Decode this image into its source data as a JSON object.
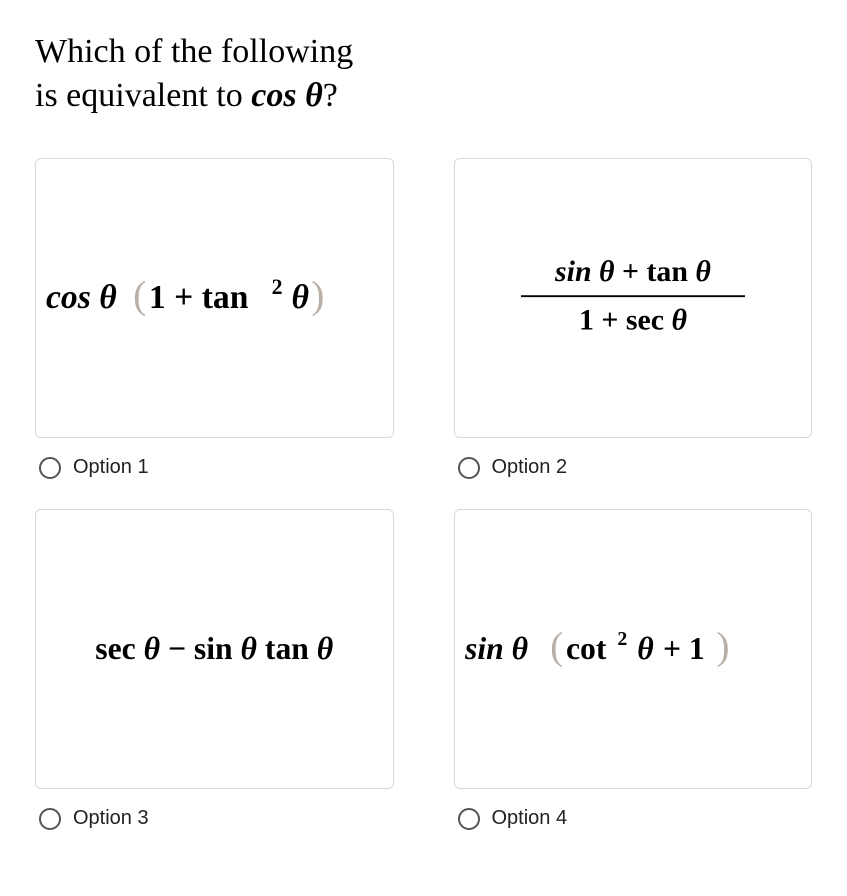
{
  "question": {
    "line1": "Which of the following",
    "line2_a": "is equivalent to ",
    "line2_math": "cos θ",
    "line2_b": "?"
  },
  "options": [
    {
      "label": "Option 1",
      "math": "cos θ (1 + tan² θ)"
    },
    {
      "label": "Option 2",
      "math": "(sin θ + tan θ) / (1 + sec θ)"
    },
    {
      "label": "Option 3",
      "math": "sec θ − sin θ tan θ"
    },
    {
      "label": "Option 4",
      "math": "sin θ (cot² θ + 1)"
    }
  ]
}
